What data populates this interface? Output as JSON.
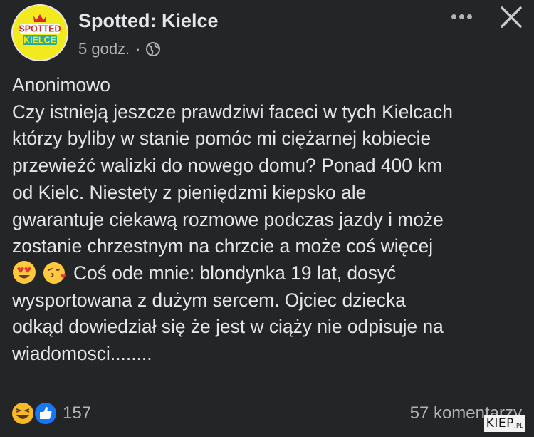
{
  "post": {
    "page_name": "Spotted: Kielce",
    "avatar_text_line1": "SPOTTED",
    "avatar_text_line2": "KIELCE",
    "time": "5 godz.",
    "separator": "·",
    "audience_icon": "globe-icon",
    "more_icon": "more-horizontal-icon",
    "close_icon": "close-icon",
    "body": {
      "author_label": "Anonimowo",
      "paragraph": "Czy istnieją jeszcze prawdziwi faceci w tych Kielcach\nktórzy byliby w stanie pomóc mi ciężarnej kobiecie\nprzewieźć walizki do nowego domu? Ponad 400 km\nod Kielc. Niestety z pieniędzmi kiepsko ale\ngwarantuje ciekawą rozmowe podczas jazdy i może\nzostanie chrzestnym na chrzcie a może coś więcej",
      "emojis": [
        "heart-eyes-emoji",
        "kissing-heart-emoji"
      ],
      "paragraph2": "Coś ode mnie: blondynka 19 lat, dosyć\nwysportowana z dużym sercem. Ojciec dziecka\nodkąd dowiedział się że jest w ciąży nie odpisuje na\nwiadomosci........"
    },
    "footer": {
      "reaction_icons": [
        "haha-reaction-icon",
        "like-reaction-icon"
      ],
      "reaction_count": "157",
      "comments": "57 komentarzy"
    }
  },
  "watermark": {
    "main": "KIEP",
    "suffix": ".PL"
  },
  "colors": {
    "background": "#242526",
    "text": "#e4e6eb",
    "secondary": "#b0b3b8",
    "like_blue": "#1877f2"
  }
}
